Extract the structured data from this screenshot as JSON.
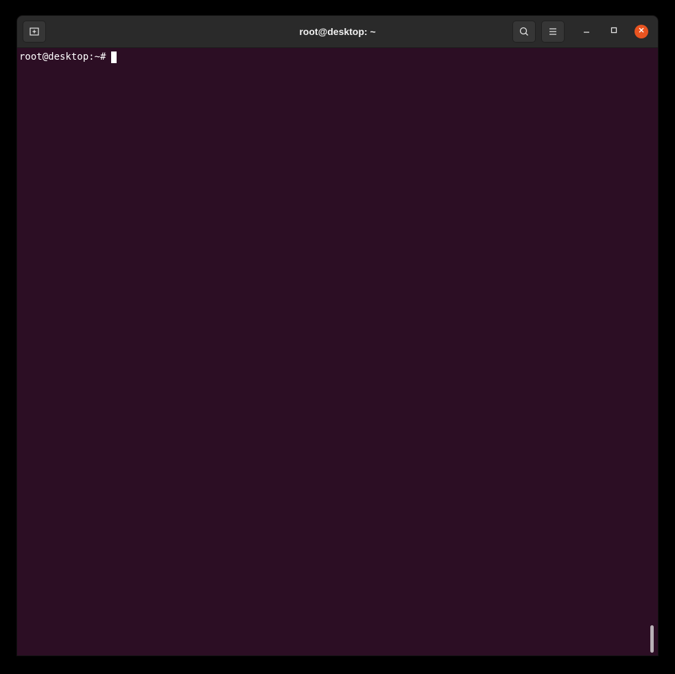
{
  "window": {
    "title": "root@desktop: ~"
  },
  "titlebar": {
    "new_tab_icon": "new-tab-icon",
    "search_icon": "search-icon",
    "menu_icon": "hamburger-menu-icon",
    "minimize_icon": "minimize-icon",
    "maximize_icon": "maximize-icon",
    "close_icon": "close-icon"
  },
  "terminal": {
    "prompt": "root@desktop:~#",
    "input": ""
  },
  "colors": {
    "terminal_bg": "#2c0e24",
    "titlebar_bg": "#2a2a2a",
    "close_accent": "#e95420",
    "text": "#ffffff"
  }
}
